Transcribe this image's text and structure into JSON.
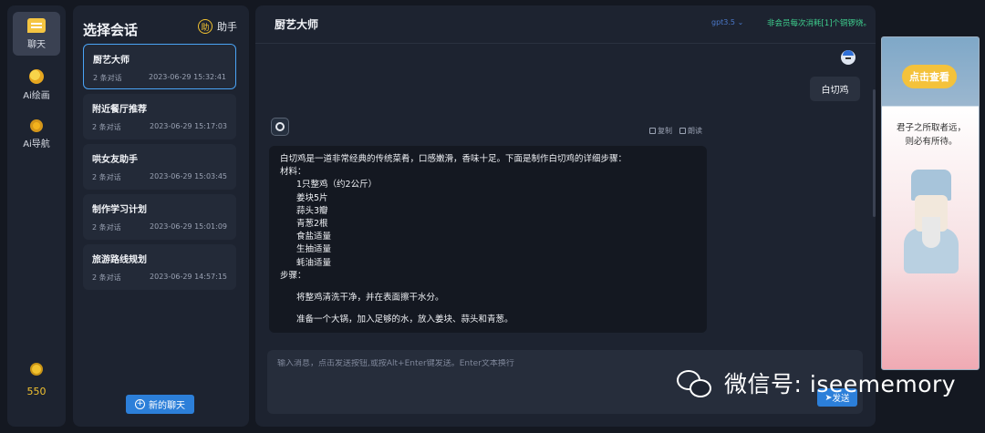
{
  "rail": {
    "items": [
      {
        "label": "聊天",
        "icon": "chat-icon"
      },
      {
        "label": "Ai绘画",
        "icon": "paint-icon"
      },
      {
        "label": "Ai导航",
        "icon": "compass-icon"
      }
    ],
    "coins": "550"
  },
  "sidebar": {
    "title": "选择会话",
    "assistant_label": "助手",
    "assistant_icon_text": "助",
    "conversations": [
      {
        "title": "厨艺大师",
        "count": "2 条对话",
        "time": "2023-06-29 15:32:41"
      },
      {
        "title": "附近餐厅推荐",
        "count": "2 条对话",
        "time": "2023-06-29 15:17:03"
      },
      {
        "title": "哄女友助手",
        "count": "2 条对话",
        "time": "2023-06-29 15:03:45"
      },
      {
        "title": "制作学习计划",
        "count": "2 条对话",
        "time": "2023-06-29 15:01:09"
      },
      {
        "title": "旅游路线规划",
        "count": "2 条对话",
        "time": "2023-06-29 14:57:15"
      }
    ],
    "new_chat_label": "新的聊天"
  },
  "main": {
    "title": "厨艺大师",
    "model": "gpt3.5",
    "notice": "非会员每次消耗[1]个铜锣烧。",
    "user_message": "白切鸡",
    "bot_actions": {
      "copy": "复制",
      "read": "朗读"
    },
    "bot_lines": [
      "白切鸡是一道非常经典的传统菜肴，口感嫩滑，香味十足。下面是制作白切鸡的详细步骤：",
      "材料："
    ],
    "ingredients": [
      "1只整鸡（约2公斤）",
      "姜块5片",
      "蒜头3瓣",
      "青葱2根",
      "食盐适量",
      "生抽适量",
      "蚝油适量"
    ],
    "steps_label": "步骤：",
    "steps": [
      "将整鸡清洗干净，并在表面擦干水分。",
      "准备一个大锅，加入足够的水，放入姜块、蒜头和青葱。"
    ],
    "composer_placeholder": "输入消息，点击发送按钮,或按Alt+Enter键发送。Enter文本换行",
    "send_label": "发送"
  },
  "watermark": "微信号: iseememory",
  "ad": {
    "badge": "点击查看",
    "quote_line1": "君子之所取者远，",
    "quote_line2": "则必有所待。"
  }
}
